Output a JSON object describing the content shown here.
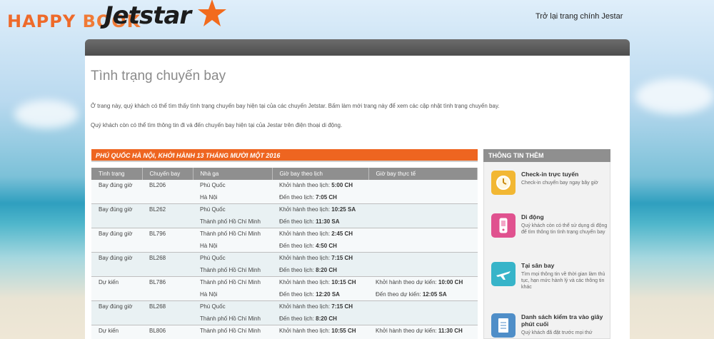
{
  "header": {
    "happy_book": "HAPPY BOOK",
    "happy_book_part1": "HAPPY ",
    "happy_book_part2": "BOOK",
    "logo_text": "Jetstar",
    "back_link": "Trở lại trang chính Jestar"
  },
  "page": {
    "title": "Tình trạng chuyến bay",
    "intro1": "Ở trang này, quý khách có thể tìm thấy tình trạng chuyến bay hiện tại của các chuyến Jetstar. Bấm làm mới trang này để xem các cập nhật tình trạng chuyến bay.",
    "intro2": "Quý khách còn có thể tìm thông tin đi và đến chuyến bay hiện tại của Jestar trên điện thoại di động."
  },
  "flights": {
    "heading": "PHÚ QUỐC HÀ NỘI, KHỞI HÀNH 13 THÁNG MƯỜI MỘT 2016",
    "columns": [
      "Tình trạng",
      "Chuyến bay",
      "Nhà ga",
      "Giờ bay theo lịch",
      "Giờ bay thực tế"
    ],
    "rows": [
      {
        "status": "Bay đúng giờ",
        "flight": "BL206",
        "stations": [
          "Phú Quốc",
          "Hà Nội"
        ],
        "scheduled": [
          [
            "Khởi hành theo lịch: ",
            "5:00 CH"
          ],
          [
            "Đến theo lịch: ",
            "7:05 CH"
          ]
        ],
        "actual": [
          [
            "",
            ""
          ],
          [
            "",
            ""
          ]
        ]
      },
      {
        "status": "Bay đúng giờ",
        "flight": "BL262",
        "stations": [
          "Phú Quốc",
          "Thành phố Hồ Chí Minh"
        ],
        "scheduled": [
          [
            "Khởi hành theo lịch: ",
            "10:25 SA"
          ],
          [
            "Đến theo lịch: ",
            "11:30 SA"
          ]
        ],
        "actual": [
          [
            "",
            ""
          ],
          [
            "",
            ""
          ]
        ]
      },
      {
        "status": "Bay đúng giờ",
        "flight": "BL796",
        "stations": [
          "Thành phố Hồ Chí Minh",
          "Hà Nội"
        ],
        "scheduled": [
          [
            "Khởi hành theo lịch: ",
            "2:45 CH"
          ],
          [
            "Đến theo lịch: ",
            "4:50 CH"
          ]
        ],
        "actual": [
          [
            "",
            ""
          ],
          [
            "",
            ""
          ]
        ]
      },
      {
        "status": "Bay đúng giờ",
        "flight": "BL268",
        "stations": [
          "Phú Quốc",
          "Thành phố Hồ Chí Minh"
        ],
        "scheduled": [
          [
            "Khởi hành theo lịch: ",
            "7:15 CH"
          ],
          [
            "Đến theo lịch: ",
            "8:20 CH"
          ]
        ],
        "actual": [
          [
            "",
            ""
          ],
          [
            "",
            ""
          ]
        ]
      },
      {
        "status": "Dự kiến",
        "flight": "BL786",
        "stations": [
          "Thành phố Hồ Chí Minh",
          "Hà Nội"
        ],
        "scheduled": [
          [
            "Khởi hành theo lịch: ",
            "10:15 CH"
          ],
          [
            "Đến theo lịch: ",
            "12:20 SA"
          ]
        ],
        "actual": [
          [
            "Khởi hành theo dự kiến: ",
            "10:00 CH"
          ],
          [
            "Đến theo dự kiến: ",
            "12:05 SA"
          ]
        ]
      },
      {
        "status": "Bay đúng giờ",
        "flight": "BL268",
        "stations": [
          "Phú Quốc",
          "Thành phố Hồ Chí Minh"
        ],
        "scheduled": [
          [
            "Khởi hành theo lịch: ",
            "7:15 CH"
          ],
          [
            "Đến theo lịch: ",
            "8:20 CH"
          ]
        ],
        "actual": [
          [
            "",
            ""
          ],
          [
            "",
            ""
          ]
        ]
      },
      {
        "status": "Dự kiến",
        "flight": "BL806",
        "stations": [
          "Thành phố Hồ Chí Minh",
          ""
        ],
        "scheduled": [
          [
            "Khởi hành theo lịch: ",
            "10:55 CH"
          ],
          [
            "",
            ""
          ]
        ],
        "actual": [
          [
            "Khởi hành theo dự kiến: ",
            "11:30 CH"
          ],
          [
            "",
            ""
          ]
        ]
      }
    ]
  },
  "sidebar": {
    "heading": "THÔNG TIN THÊM",
    "items": [
      {
        "title": "Check-in trực tuyến",
        "desc": "Check-in chuyến bay ngay bây giờ",
        "icon": "clock-icon",
        "color": "#f2b733"
      },
      {
        "title": "Di động",
        "desc": "Quý khách còn có thể sử dụng di động để tìm thông tin tình trạng chuyến bay",
        "icon": "mobile-phone-icon",
        "color": "#e0528f"
      },
      {
        "title": "Tại sân bay",
        "desc": "Tìm mọi thông tin về thời gian làm thủ tục, hạn mức hành lý và các thông tin khác",
        "icon": "airplane-icon",
        "color": "#37b4c9"
      },
      {
        "title": "Danh sách kiểm tra vào giây phút cuối",
        "desc": "Quý khách đã đặt trước mọi thứ",
        "icon": "checklist-icon",
        "color": "#4f8ec8"
      }
    ]
  },
  "colors": {
    "accent_orange": "#ee6520",
    "header_grey": "#8f8f8f",
    "brand_orange": "#ee6a2a"
  }
}
